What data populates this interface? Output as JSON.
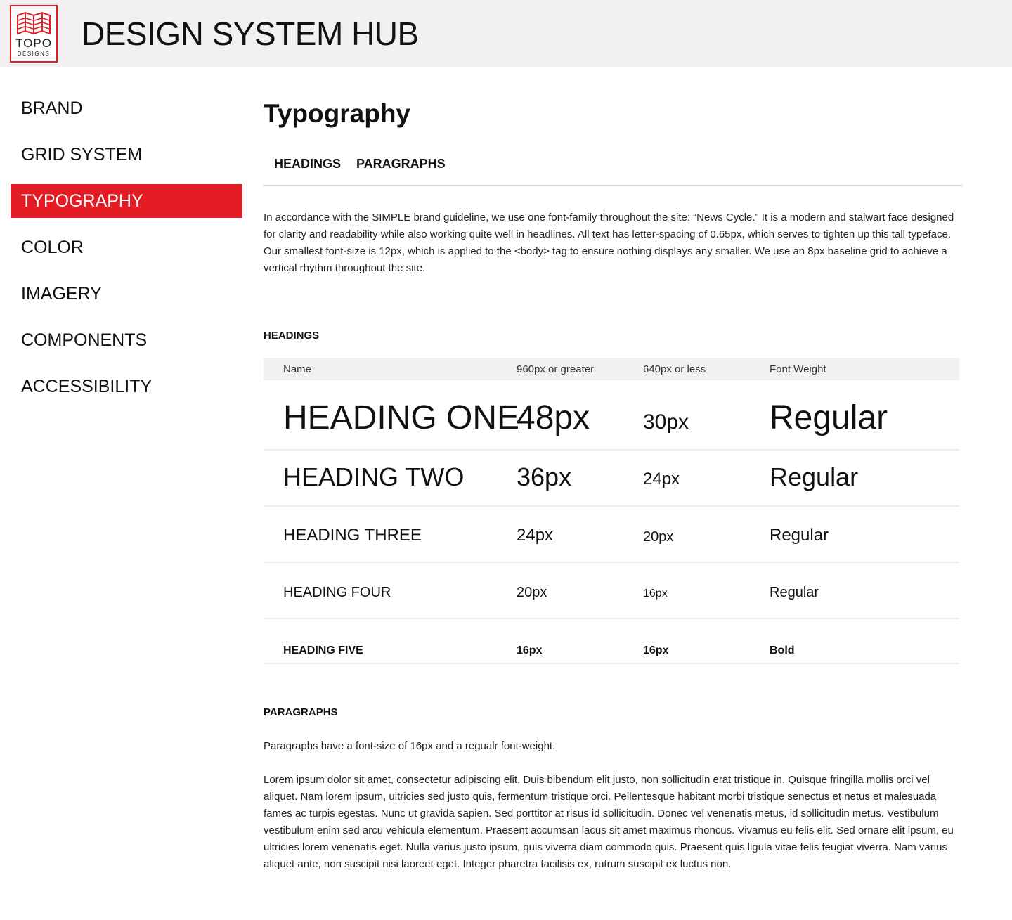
{
  "header": {
    "logo_top": "TOPO",
    "logo_bottom": "DESIGNS",
    "title": "DESIGN SYSTEM HUB",
    "background": "#f1f1f1"
  },
  "sidebar": {
    "active_color": "#e31b23",
    "items": [
      {
        "label": "BRAND",
        "active": false
      },
      {
        "label": "GRID SYSTEM",
        "active": false
      },
      {
        "label": "TYPOGRAPHY",
        "active": true
      },
      {
        "label": "COLOR",
        "active": false
      },
      {
        "label": "IMAGERY",
        "active": false
      },
      {
        "label": "COMPONENTS",
        "active": false
      },
      {
        "label": "ACCESSIBILITY",
        "active": false
      }
    ]
  },
  "main": {
    "title": "Typography",
    "tabs": [
      {
        "label": "HEADINGS"
      },
      {
        "label": "PARAGRAPHS"
      }
    ],
    "intro": "In accordance with the SIMPLE brand guideline, we use one font-family throughout the site: “News Cycle.” It is a modern and stalwart face designed for clarity and readability while also working quite well in headlines. All text has letter-spacing of 0.65px, which serves to tighten up this tall typeface. Our smallest font-size is 12px, which is applied to the <body> tag to ensure nothing displays any smaller. We use an 8px baseline grid to achieve a vertical rhythm throughout the site.",
    "headings_section": {
      "title": "HEADINGS",
      "columns": [
        "Name",
        "960px or greater",
        "640px or less",
        "Font Weight"
      ],
      "rows": [
        {
          "name": "HEADING ONE",
          "desktop": "48px",
          "mobile": "30px",
          "weight": "Regular"
        },
        {
          "name": "HEADING TWO",
          "desktop": "36px",
          "mobile": "24px",
          "weight": "Regular"
        },
        {
          "name": "HEADING THREE",
          "desktop": "24px",
          "mobile": "20px",
          "weight": "Regular"
        },
        {
          "name": "HEADING FOUR",
          "desktop": "20px",
          "mobile": "16px",
          "weight": "Regular"
        },
        {
          "name": "HEADING FIVE",
          "desktop": "16px",
          "mobile": "16px",
          "weight": "Bold"
        }
      ]
    },
    "paragraphs_section": {
      "title": "PARAGRAPHS",
      "note": "Paragraphs have a font-size of 16px and a regualr font-weight.",
      "lorem": "Lorem ipsum dolor sit amet, consectetur adipiscing elit. Duis bibendum elit justo, non sollicitudin erat tristique in. Quisque fringilla mollis orci vel aliquet. Nam lorem ipsum, ultricies sed justo quis, fermentum tristique orci. Pellentesque habitant morbi tristique senectus et netus et malesuada fames ac turpis egestas. Nunc ut gravida sapien. Sed porttitor at risus id sollicitudin. Donec vel venenatis metus, id sollicitudin metus. Vestibulum vestibulum enim sed arcu vehicula elementum. Praesent accumsan lacus sit amet maximus rhoncus. Vivamus eu felis elit. Sed ornare elit ipsum, eu ultricies lorem venenatis eget. Nulla varius justo ipsum, quis viverra diam commodo quis. Praesent quis ligula vitae felis feugiat viverra. Nam varius aliquet ante, non suscipit nisi laoreet eget. Integer pharetra facilisis ex, rutrum suscipit ex luctus non."
    }
  }
}
